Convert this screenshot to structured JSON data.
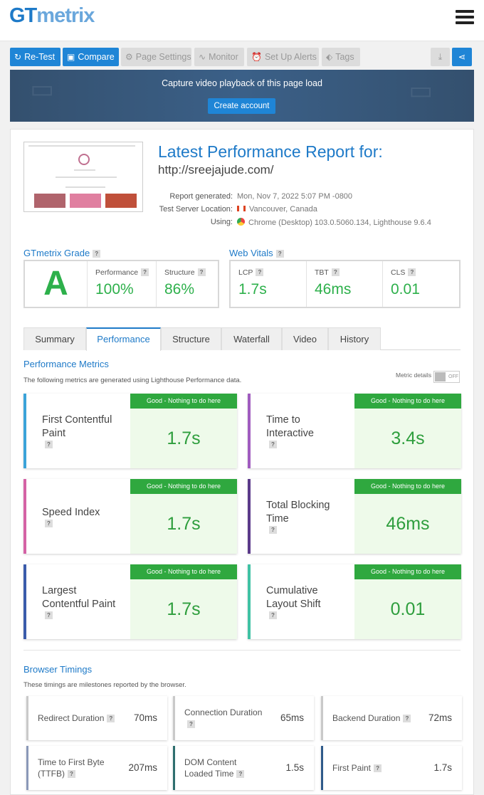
{
  "header": {
    "logo_gt": "GT",
    "logo_metrix": "metrix"
  },
  "toolbar": {
    "retest": "Re-Test",
    "compare": "Compare",
    "page_settings": "Page Settings",
    "monitor": "Monitor",
    "alerts": "Set Up Alerts",
    "tags": "Tags"
  },
  "banner": {
    "text": "Capture video playback of this page load",
    "button": "Create account"
  },
  "report": {
    "title": "Latest Performance Report for:",
    "url": "http://sreejajude.com/",
    "generated_label": "Report generated:",
    "generated_value": "Mon, Nov 7, 2022 5:07 PM -0800",
    "server_label": "Test Server Location:",
    "server_value": "Vancouver, Canada",
    "using_label": "Using:",
    "using_value": "Chrome (Desktop) 103.0.5060.134, Lighthouse 9.6.4"
  },
  "grade": {
    "title": "GTmetrix Grade",
    "letter": "A",
    "performance_label": "Performance",
    "performance_value": "100%",
    "structure_label": "Structure",
    "structure_value": "86%"
  },
  "vitals": {
    "title": "Web Vitals",
    "lcp_label": "LCP",
    "lcp_value": "1.7s",
    "tbt_label": "TBT",
    "tbt_value": "46ms",
    "cls_label": "CLS",
    "cls_value": "0.01"
  },
  "tabs": [
    "Summary",
    "Performance",
    "Structure",
    "Waterfall",
    "Video",
    "History"
  ],
  "performance": {
    "title": "Performance Metrics",
    "subtitle": "The following metrics are generated using Lighthouse Performance data.",
    "metric_details": "Metric details",
    "toggle": "OFF",
    "badge": "Good - Nothing to do here",
    "metrics": [
      {
        "line1": "First Contentful",
        "line2": "Paint",
        "line3": "",
        "value": "1.7s",
        "color": "#3ba3d9"
      },
      {
        "line1": "Time to",
        "line2": "Interactive",
        "line3": "",
        "value": "3.4s",
        "color": "#a05cbf"
      },
      {
        "line1": "Speed Index",
        "line2": "",
        "line3": "",
        "value": "1.7s",
        "color": "#d462a5"
      },
      {
        "line1": "Total Blocking",
        "line2": "Time",
        "line3": "",
        "value": "46ms",
        "color": "#5b3a8a"
      },
      {
        "line1": "Largest",
        "line2": "Contentful Paint",
        "line3": "",
        "value": "1.7s",
        "color": "#3a5cab"
      },
      {
        "line1": "Cumulative",
        "line2": "Layout Shift",
        "line3": "",
        "value": "0.01",
        "color": "#40c2a4"
      }
    ]
  },
  "timings": {
    "title": "Browser Timings",
    "subtitle": "These timings are milestones reported by the browser.",
    "items": [
      {
        "line1": "Redirect Duration",
        "line2": "",
        "value": "70ms",
        "color": "#c9c9c9"
      },
      {
        "line1": "Connection Duration",
        "line2": "",
        "value": "65ms",
        "color": "#c9c9c9"
      },
      {
        "line1": "Backend Duration",
        "line2": "",
        "value": "72ms",
        "color": "#c9c9c9"
      },
      {
        "line1": "Time to First Byte",
        "line2": "(TTFB)",
        "value": "207ms",
        "color": "#8a98b8"
      },
      {
        "line1": "DOM Content",
        "line2": "Loaded Time",
        "value": "1.5s",
        "color": "#2e6e6e"
      },
      {
        "line1": "First Paint",
        "line2": "",
        "value": "1.7s",
        "color": "#2f5a8a"
      }
    ]
  }
}
